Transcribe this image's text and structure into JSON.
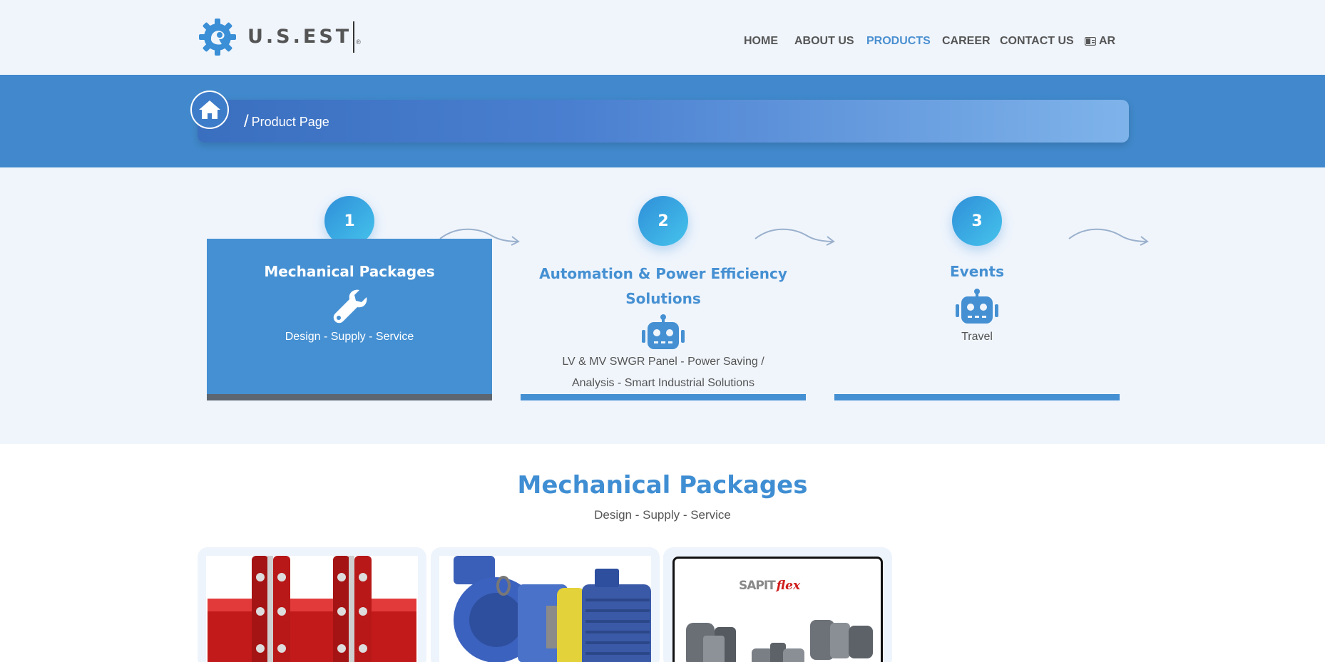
{
  "header": {
    "logo_text": "U.S.EST",
    "logo_mark": "®",
    "nav": [
      {
        "label": "HOME",
        "active": false
      },
      {
        "label": "ABOUT US",
        "active": false
      },
      {
        "label": "PRODUCTS",
        "active": true
      },
      {
        "label": "CAREER",
        "active": false
      },
      {
        "label": "CONTACT US",
        "active": false
      }
    ],
    "lang_label": "AR",
    "lang_icon": "language-icon"
  },
  "breadcrumb": {
    "home_icon": "home-icon",
    "separator": "/",
    "current": "Product Page"
  },
  "steps": [
    {
      "number": "1",
      "title": "Mechanical Packages",
      "icon": "wrench-icon",
      "description": "Design - Supply - Service",
      "active": true
    },
    {
      "number": "2",
      "title": "Automation & Power Efficiency Solutions",
      "icon": "robot-icon",
      "description": "LV & MV SWGR Panel - Power Saving / Analysis - Smart Industrial Solutions",
      "active": false
    },
    {
      "number": "3",
      "title": "Events",
      "icon": "robot-icon",
      "description": "Travel",
      "active": false
    }
  ],
  "section": {
    "title": "Mechanical Packages",
    "subtitle": "Design - Supply - Service"
  },
  "cards": [
    {
      "image": "coupling-image"
    },
    {
      "image": "pump-motor-image"
    },
    {
      "image": "sapit-flex-image",
      "brand_a": "SAPIT",
      "brand_b": "flex"
    }
  ],
  "colors": {
    "accent": "#4590d2",
    "banner": "#4189cc",
    "background": "#f0f5fc"
  }
}
